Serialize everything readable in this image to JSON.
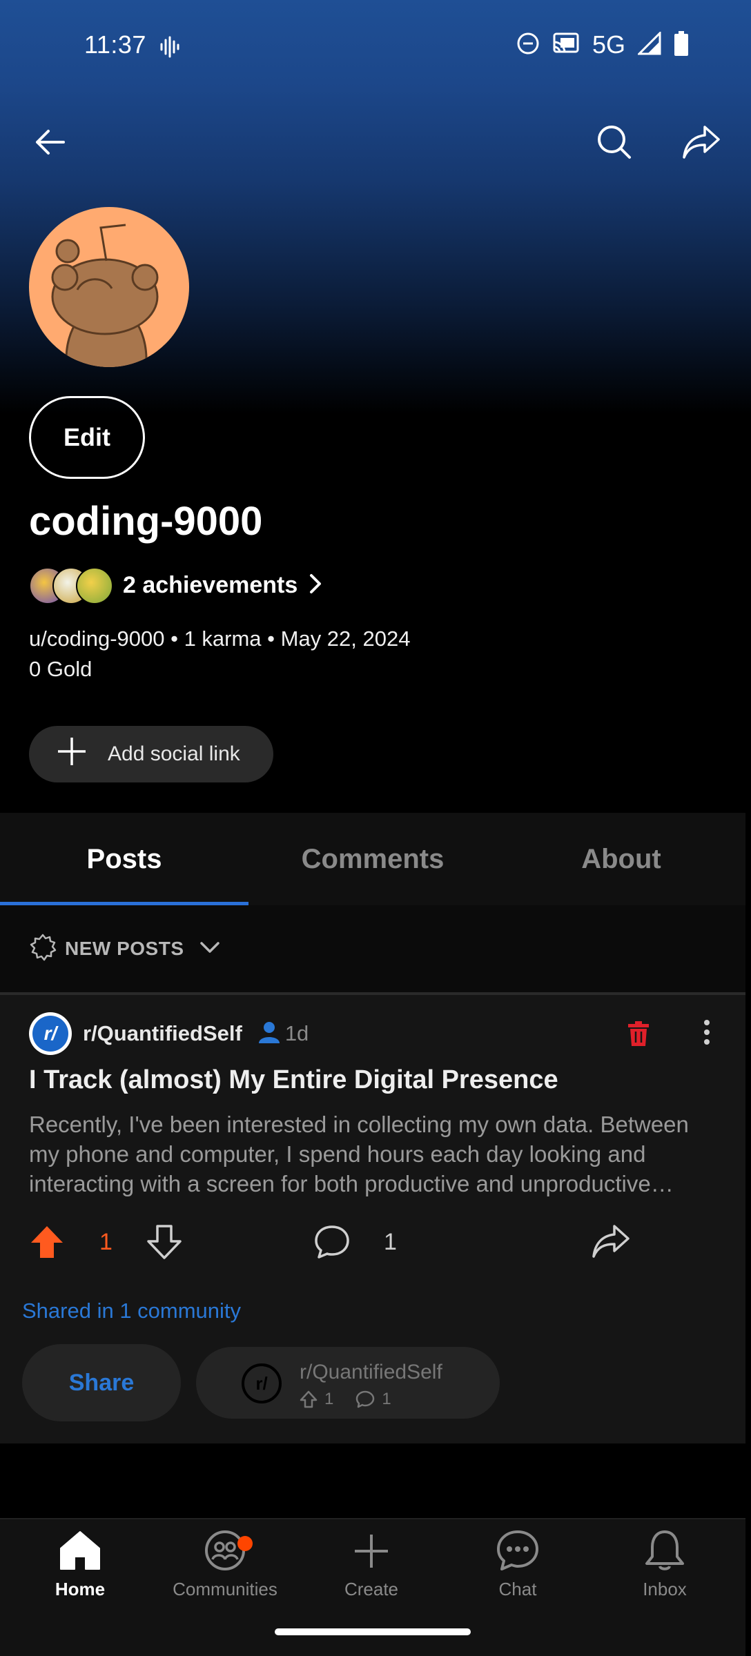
{
  "status_bar": {
    "time": "11:37",
    "network": "5G"
  },
  "profile": {
    "edit_label": "Edit",
    "display_name": "coding-9000",
    "achievements_label": "2 achievements",
    "meta_line": "u/coding-9000 • 1 karma • May 22, 2024",
    "gold_line": "0 Gold",
    "add_social_label": "Add social link",
    "avatar_color": "#ffaa70"
  },
  "tabs": [
    {
      "label": "Posts",
      "active": true
    },
    {
      "label": "Comments",
      "active": false
    },
    {
      "label": "About",
      "active": false
    }
  ],
  "sort": {
    "label": "NEW POSTS"
  },
  "post": {
    "subreddit": "r/QuantifiedSelf",
    "age": "1d",
    "title": "I Track (almost) My Entire Digital Presence",
    "body": "Recently, I've been interested in collecting my own data. Between my phone and computer, I spend hours each day looking and interacting with a screen for both productive and unproductive purposes.",
    "upvotes": "1",
    "comments": "1",
    "shared_label": "Shared in 1 community",
    "share_label": "Share",
    "crosspost": {
      "subreddit": "r/QuantifiedSelf",
      "upvotes": "1",
      "comments": "1"
    }
  },
  "bottom_nav": [
    {
      "label": "Home",
      "icon": "home-icon",
      "active": true
    },
    {
      "label": "Communities",
      "icon": "communities-icon",
      "active": false
    },
    {
      "label": "Create",
      "icon": "plus-icon",
      "active": false
    },
    {
      "label": "Chat",
      "icon": "chat-icon",
      "active": false
    },
    {
      "label": "Inbox",
      "icon": "bell-icon",
      "active": false
    }
  ],
  "colors": {
    "accent_blue": "#2a78d6",
    "upvote_orange": "#ff5a1f",
    "delete_red": "#e0202a",
    "notification": "#ff4500"
  }
}
